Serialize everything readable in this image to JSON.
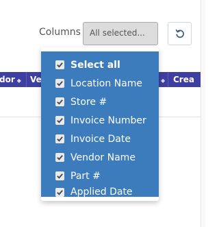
{
  "toolbar": {
    "columns_label": "Columns",
    "select_value": "All selected...",
    "reset_icon": "reset-icon"
  },
  "table": {
    "headers": [
      {
        "label": "dor",
        "sort_icon": "sort-icon"
      },
      {
        "label": "Ve",
        "sort_icon": "sort-icon"
      },
      {
        "label": "Crea",
        "sort_icon": "sort-icon"
      }
    ]
  },
  "dropdown": {
    "items": [
      {
        "label": "Select all",
        "checked": true
      },
      {
        "label": "Location Name",
        "checked": true
      },
      {
        "label": "Store #",
        "checked": true
      },
      {
        "label": "Invoice Number",
        "checked": true
      },
      {
        "label": "Invoice Date",
        "checked": true
      },
      {
        "label": "Vendor Name",
        "checked": true
      },
      {
        "label": "Part #",
        "checked": true
      },
      {
        "label": "Applied Date",
        "checked": true
      }
    ]
  },
  "colors": {
    "header_bg": "#3f3fa1",
    "dropdown_bg": "#3c7cbc",
    "select_bg": "#dcdcdc"
  }
}
